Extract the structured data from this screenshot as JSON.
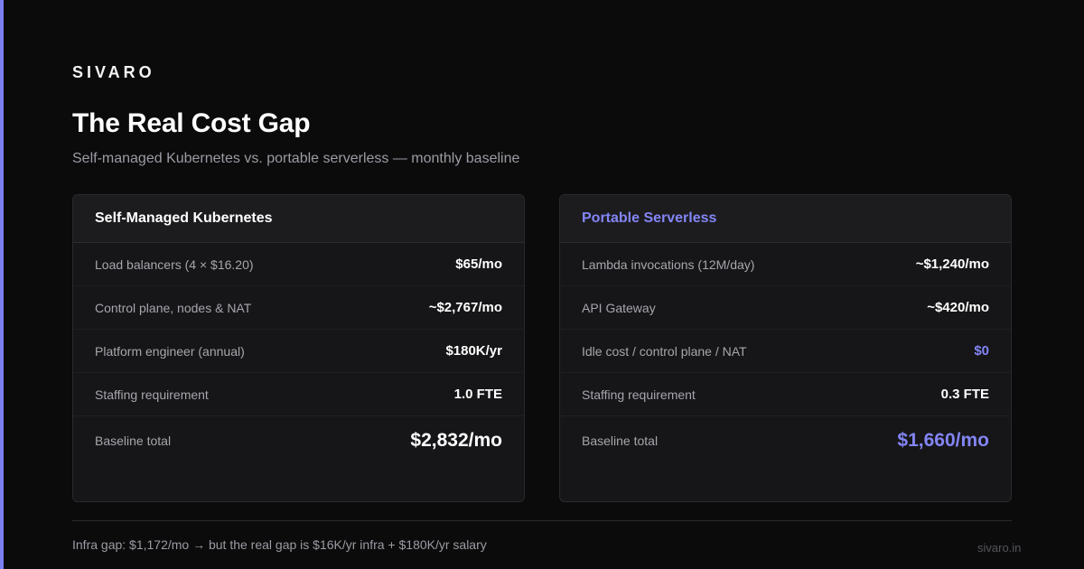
{
  "brand": "SIVARO",
  "title": "The Real Cost Gap",
  "subtitle": "Self-managed Kubernetes vs. portable serverless — monthly baseline",
  "colors": {
    "accent": "#8385f5",
    "background": "#0b0b0c",
    "card": "#161618"
  },
  "left_card": {
    "header": "Self-Managed Kubernetes",
    "rows": [
      {
        "label": "Load balancers (4 × $16.20)",
        "value": "$65/mo"
      },
      {
        "label": "Control plane, nodes & NAT",
        "value": "~$2,767/mo"
      },
      {
        "label": "Platform engineer (annual)",
        "value": "$180K/yr"
      },
      {
        "label": "Staffing requirement",
        "value": "1.0 FTE"
      }
    ],
    "total": {
      "label": "Baseline total",
      "value": "$2,832/mo"
    }
  },
  "right_card": {
    "header": "Portable Serverless",
    "rows": [
      {
        "label": "Lambda invocations (12M/day)",
        "value": "~$1,240/mo"
      },
      {
        "label": "API Gateway",
        "value": "~$420/mo"
      },
      {
        "label": "Idle cost / control plane / NAT",
        "value": "$0"
      },
      {
        "label": "Staffing requirement",
        "value": "0.3 FTE"
      }
    ],
    "total": {
      "label": "Baseline total",
      "value": "$1,660/mo"
    }
  },
  "footnote": "Infra gap: $1,172/mo → but the real gap is $16K/yr infra + $180K/yr salary",
  "domain": "sivaro.in"
}
